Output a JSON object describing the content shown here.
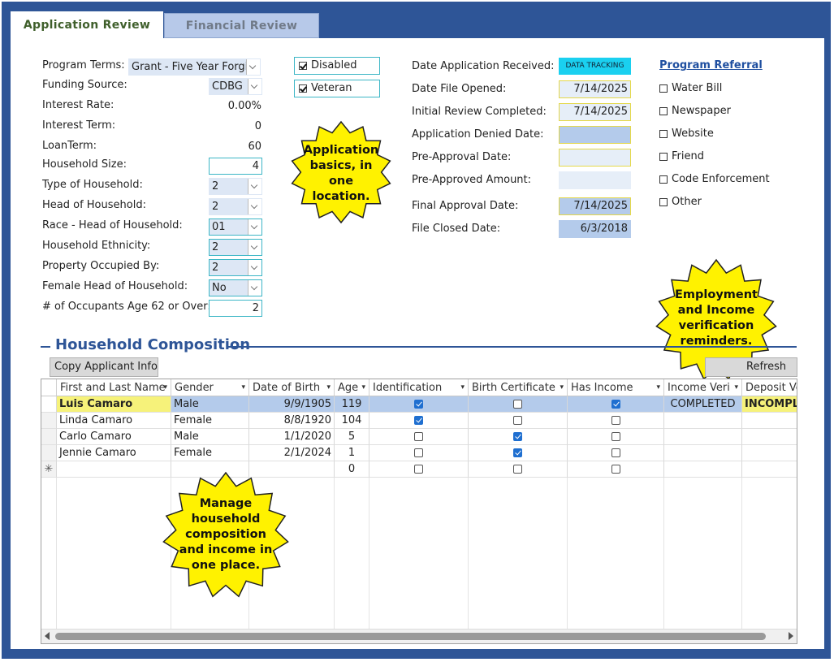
{
  "tabs": [
    "Application Review",
    "Financial Review"
  ],
  "left_fields": [
    {
      "label": "Program Terms:",
      "value": "Grant - Five Year Forgiv",
      "kind": "combo"
    },
    {
      "label": "Funding Source:",
      "value": "CDBG",
      "kind": "combo"
    },
    {
      "label": "Interest Rate:",
      "value": "0.00%",
      "kind": "text"
    },
    {
      "label": "Interest Term:",
      "value": "0",
      "kind": "text"
    },
    {
      "label": "LoanTerm:",
      "value": "60",
      "kind": "text"
    },
    {
      "label": "Household Size:",
      "value": "4",
      "kind": "input"
    },
    {
      "label": "Type of Household:",
      "value": "2",
      "kind": "combo"
    },
    {
      "label": "Head of Household:",
      "value": "2",
      "kind": "combo"
    },
    {
      "label": "Race - Head of Household:",
      "value": "01",
      "kind": "combo"
    },
    {
      "label": "Household Ethnicity:",
      "value": "2",
      "kind": "combo"
    },
    {
      "label": "Property Occupied By:",
      "value": "2",
      "kind": "combo"
    },
    {
      "label": "Female Head of Household:",
      "value": "No",
      "kind": "combo"
    },
    {
      "label": "# of Occupants Age 62 or Over:",
      "value": "2",
      "kind": "input"
    }
  ],
  "flags": [
    {
      "label": "Disabled",
      "checked": true
    },
    {
      "label": "Veteran",
      "checked": true
    }
  ],
  "dates": [
    {
      "label": "Date Application Received:",
      "value": "DATA TRACKING",
      "style": "button"
    },
    {
      "label": "Date File Opened:",
      "value": "7/14/2025",
      "style": "dy"
    },
    {
      "label": "Initial Review Completed:",
      "value": "7/14/2025",
      "style": "dy"
    },
    {
      "label": "Application Denied Date:",
      "value": "",
      "style": "dby"
    },
    {
      "label": "Pre-Approval Date:",
      "value": "",
      "style": "dy"
    },
    {
      "label": "Pre-Approved Amount:",
      "value": "",
      "style": "dl"
    },
    {
      "label": "Final Approval Date:",
      "value": "7/14/2025",
      "style": "dby"
    },
    {
      "label": "File Closed Date:",
      "value": "6/3/2018",
      "style": "db"
    }
  ],
  "referral": {
    "title": "Program Referral",
    "items": [
      "Water Bill",
      "Newspaper",
      "Website",
      "Friend",
      "Code Enforcement",
      "Other"
    ]
  },
  "callouts": {
    "basics": [
      "Application",
      "basics, in",
      "one",
      "location."
    ],
    "employment": [
      "Employment",
      "and Income",
      "verification",
      "reminders."
    ],
    "household": [
      "Manage",
      "household",
      "composition",
      "and income in",
      "one place."
    ]
  },
  "household": {
    "title": "Household Composition",
    "copy_button": "Copy Applicant Info",
    "refresh_button": "Refresh",
    "columns": [
      "First and Last Name",
      "Gender",
      "Date of Birth",
      "Age",
      "Identification",
      "Birth Certificate",
      "Has Income",
      "Income Veri",
      "Deposit Ve"
    ],
    "rows": [
      {
        "name": "Luis Camaro",
        "gender": "Male",
        "dob": "9/9/1905",
        "age": "119",
        "id": true,
        "birth": false,
        "income": true,
        "income_veri": "COMPLETED",
        "deposit": "INCOMPL"
      },
      {
        "name": "Linda Camaro",
        "gender": "Female",
        "dob": "8/8/1920",
        "age": "104",
        "id": true,
        "birth": false,
        "income": false,
        "income_veri": "",
        "deposit": ""
      },
      {
        "name": "Carlo Camaro",
        "gender": "Male",
        "dob": "1/1/2020",
        "age": "5",
        "id": false,
        "birth": true,
        "income": false,
        "income_veri": "",
        "deposit": ""
      },
      {
        "name": "Jennie Camaro",
        "gender": "Female",
        "dob": "2/1/2024",
        "age": "1",
        "id": false,
        "birth": true,
        "income": false,
        "income_veri": "",
        "deposit": ""
      }
    ],
    "new_row": {
      "marker": "✳",
      "age": "0"
    }
  }
}
